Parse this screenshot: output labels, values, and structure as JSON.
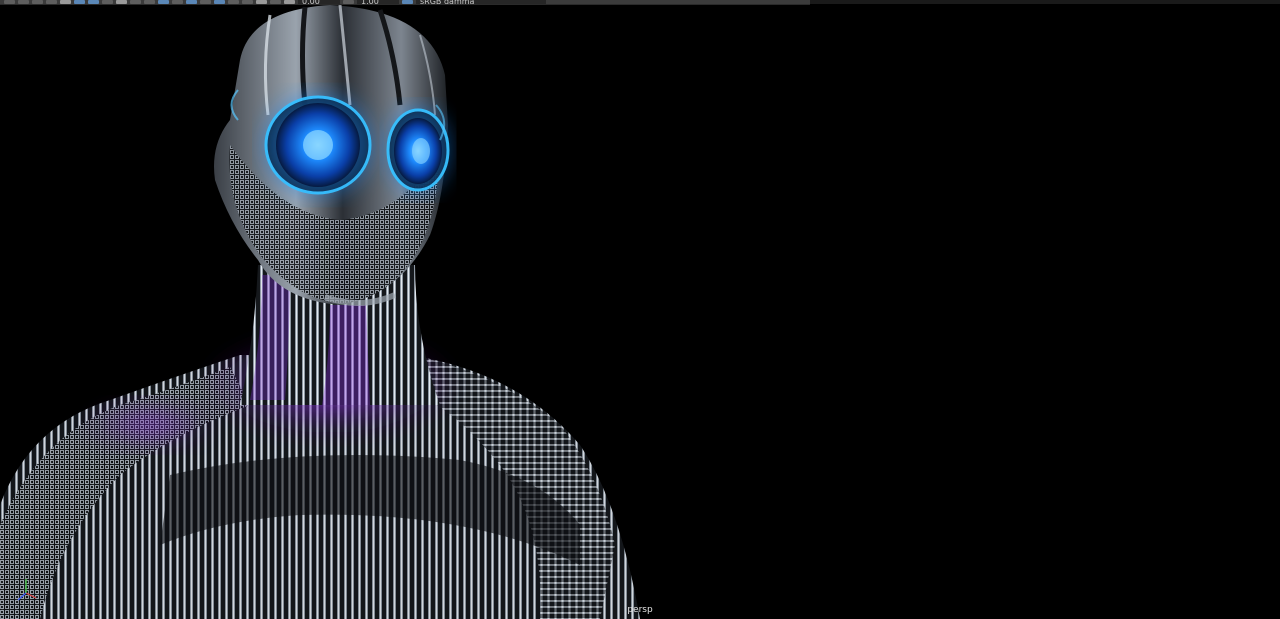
{
  "toolbar": {
    "exposure_value": "0.00",
    "gamma_value": "1.00",
    "color_management_label": "sRGB gamma",
    "buttons": [
      "select-tool-icon",
      "lasso-tool-icon",
      "paint-tool-icon",
      "move-tool-icon",
      "grid-icon",
      "film-gate-icon",
      "resolution-gate-icon",
      "safe-action-icon",
      "wireframe-icon",
      "smooth-shade-icon",
      "textured-icon",
      "lights-icon",
      "shadows-icon",
      "ambient-occlusion-icon",
      "motion-blur-icon",
      "antialias-icon",
      "isolate-select-icon",
      "xray-icon",
      "xray-joints-icon",
      "camera-icon",
      "exposure-icon",
      "gamma-icon",
      "color-management-icon"
    ]
  },
  "viewport": {
    "camera_name": "persp",
    "background_color": "#000000"
  },
  "scene": {
    "subject": "robot-figure-render",
    "eye_glow_color": "#1e8cff",
    "accent_glow_color": "#8a2be2",
    "metal_color": "#9aa3ad"
  },
  "axis_gizmo": {
    "x_color": "#e04040",
    "y_color": "#40d040",
    "z_color": "#4060ff"
  }
}
